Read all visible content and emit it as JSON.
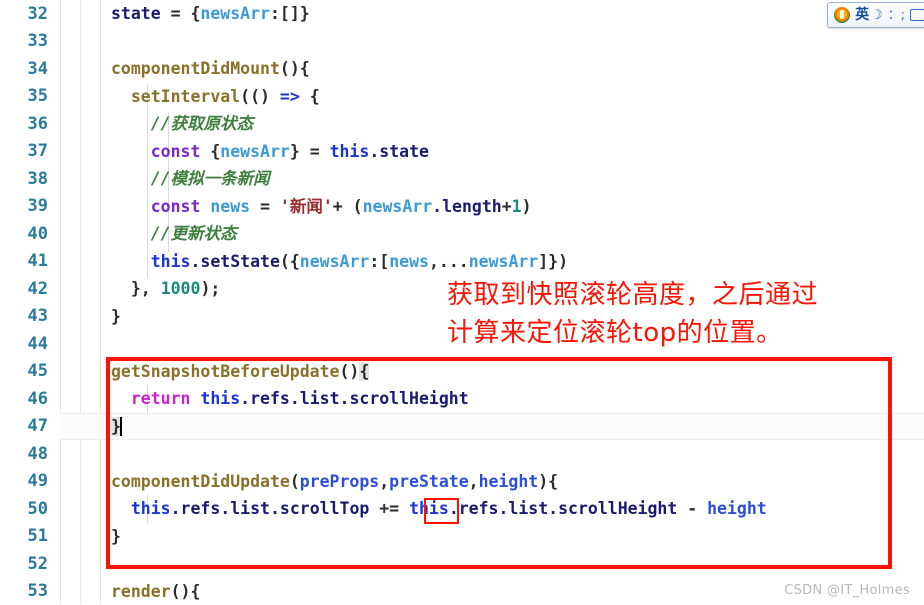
{
  "editor": {
    "first_line_number": 32,
    "line_height_px": 27.5,
    "current_line": 47,
    "lines": [
      {
        "n": "32",
        "indent": 0
      },
      {
        "n": "33",
        "indent": 0
      },
      {
        "n": "34",
        "indent": 0
      },
      {
        "n": "35",
        "indent": 0
      },
      {
        "n": "36",
        "indent": 0
      },
      {
        "n": "37",
        "indent": 0
      },
      {
        "n": "38",
        "indent": 0
      },
      {
        "n": "39",
        "indent": 0
      },
      {
        "n": "40",
        "indent": 0
      },
      {
        "n": "41",
        "indent": 0
      },
      {
        "n": "42",
        "indent": 0
      },
      {
        "n": "43",
        "indent": 0
      },
      {
        "n": "44",
        "indent": 0
      },
      {
        "n": "45",
        "indent": 0
      },
      {
        "n": "46",
        "indent": 0
      },
      {
        "n": "47",
        "indent": 0
      },
      {
        "n": "48",
        "indent": 0
      },
      {
        "n": "49",
        "indent": 0
      },
      {
        "n": "50",
        "indent": 0
      },
      {
        "n": "51",
        "indent": 0
      },
      {
        "n": "52",
        "indent": 0
      },
      {
        "n": "53",
        "indent": 0
      }
    ],
    "code_text": {
      "l32": "state = {newsArr:[]}",
      "l33": "",
      "l34": "componentDidMount(){",
      "l35": "  setInterval(() => {",
      "l36": "    //获取原状态",
      "l37": "    const {newsArr} = this.state",
      "l38": "    //模拟一条新闻",
      "l39": "    const news = '新闻'+ (newsArr.length+1)",
      "l40": "    //更新状态",
      "l41": "    this.setState({newsArr:[news,...newsArr]})",
      "l42": "  }, 1000);",
      "l43": "}",
      "l44": "",
      "l45": "getSnapshotBeforeUpdate(){",
      "l46": "  return this.refs.list.scrollHeight",
      "l47": "}",
      "l48": "",
      "l49": "componentDidUpdate(preProps,preState,height){",
      "l50": "  this.refs.list.scrollTop += this.refs.list.scrollHeight - height",
      "l51": "}",
      "l52": "",
      "l53": "render(){"
    }
  },
  "annotation": {
    "note_text": "获取到快照滚轮高度，之后通过\n计算来定位滚轮top的位置。",
    "note_color": "#fb1405",
    "box_color": "#fb1405",
    "highlighted_operator": "+="
  },
  "ime_toolbar": {
    "logo_label": "sogou-logo-icon",
    "mode_label": "英",
    "moon_label": "☽",
    "punct_label": "：;",
    "keyboard_label": "keyboard-icon"
  },
  "watermark": {
    "text": "CSDN @IT_Holmes"
  },
  "colors": {
    "keyword": "#7a28c8",
    "return": "#cc22cc",
    "this": "#1a34d6",
    "property": "#1a1a6e",
    "variable": "#3c9ad4",
    "function": "#8a7029",
    "number": "#1c8a7a",
    "string": "#9b2d2d",
    "comment": "#3f7f3f",
    "linenumber": "#2b7a9b",
    "annotation": "#fb1405",
    "background": "#ffffff"
  }
}
